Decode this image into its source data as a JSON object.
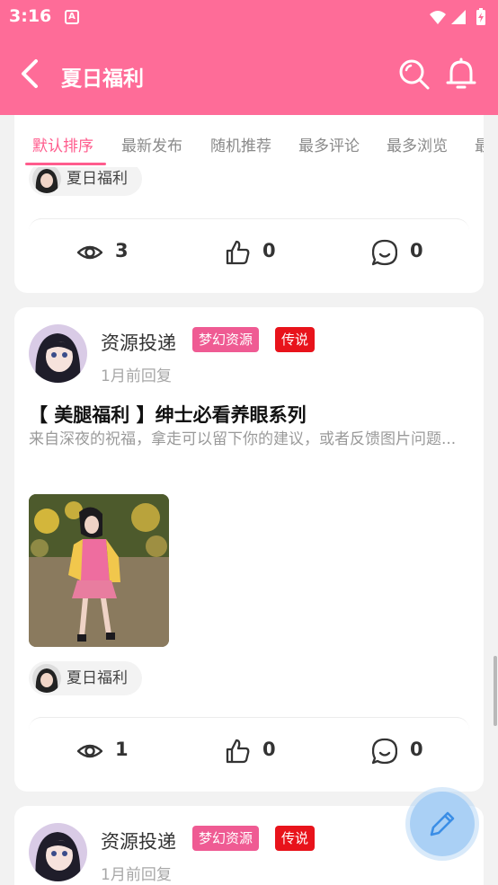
{
  "status_bar": {
    "time": "3:16",
    "notification_icon": "a-icon",
    "icons": [
      "wifi-icon",
      "signal-icon",
      "battery-icon"
    ]
  },
  "app_bar": {
    "title": "夏日福利",
    "back_icon": "back-arrow-icon",
    "search_icon": "search-icon",
    "bell_icon": "bell-icon"
  },
  "tabs": [
    {
      "label": "默认排序",
      "active": true
    },
    {
      "label": "最新发布",
      "active": false
    },
    {
      "label": "随机推荐",
      "active": false
    },
    {
      "label": "最多评论",
      "active": false
    },
    {
      "label": "最多浏览",
      "active": false
    }
  ],
  "cards": [
    {
      "tag": "夏日福利",
      "stats": {
        "views": "3",
        "likes": "0",
        "comments": "0"
      }
    },
    {
      "author": "资源投递",
      "badges": [
        "梦幻资源",
        "传说"
      ],
      "time": "1月前回复",
      "title": "【 美腿福利 】绅士必看养眼系列",
      "excerpt": "来自深夜的祝福，拿走可以留下你的建议，或者反馈图片问题...",
      "tag": "夏日福利",
      "stats": {
        "views": "1",
        "likes": "0",
        "comments": "0"
      }
    },
    {
      "author": "资源投递",
      "badges": [
        "梦幻资源",
        "传说"
      ],
      "time": "1月前回复"
    }
  ],
  "colors": {
    "primary": "#fe6c98",
    "accent": "#ff5c8d",
    "badge_pink": "#ef5b93",
    "badge_red": "#e8131b",
    "fab": "#aad0f5"
  },
  "fab_icon": "pencil-icon"
}
